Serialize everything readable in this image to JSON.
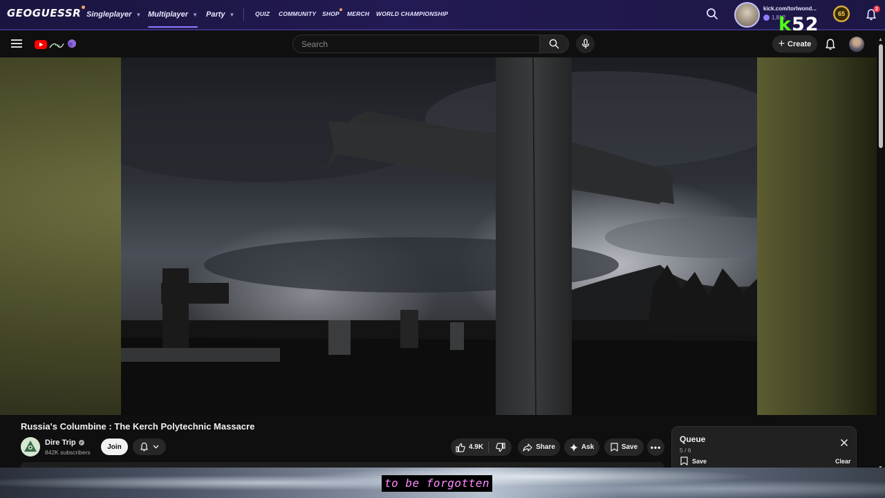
{
  "geoguessr": {
    "logo": "GEOGUESSR",
    "nav": [
      {
        "label": "Singleplayer",
        "active": false
      },
      {
        "label": "Multiplayer",
        "active": true
      },
      {
        "label": "Party",
        "active": false
      }
    ],
    "links": [
      "QUIZ",
      "COMMUNITY",
      "SHOP",
      "MERCH",
      "WORLD CHAMPIONSHIP"
    ],
    "user_name": "kick.com/torlwond...",
    "user_points": "1,812",
    "level": "65",
    "notifications": "2",
    "accent": "#8f7cff"
  },
  "kick": {
    "letter": "k",
    "number": "52",
    "color": "#53fc18"
  },
  "youtube": {
    "search_placeholder": "Search",
    "create_label": "Create",
    "video": {
      "title": "Russia's Columbine : The Kerch Polytechnic Massacre",
      "channel": "Dire Trip",
      "subscribers": "842K subscribers",
      "join_label": "Join",
      "likes": "4.9K",
      "share_label": "Share",
      "ask_label": "Ask",
      "save_label": "Save"
    },
    "queue": {
      "title": "Queue",
      "count": "5 / 6",
      "save_label": "Save",
      "clear_label": "Clear"
    }
  },
  "caption": "to be forgotten"
}
